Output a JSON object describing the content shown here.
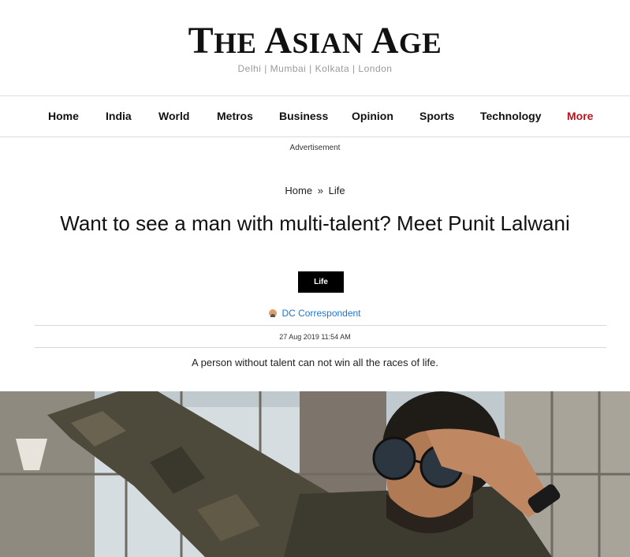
{
  "masthead": {
    "logo_text": "THE ASIAN AGE",
    "cities": "Delhi | Mumbai | Kolkata | London"
  },
  "nav": {
    "items": [
      {
        "label": "Home"
      },
      {
        "label": "India"
      },
      {
        "label": "World"
      },
      {
        "label": "Metros"
      },
      {
        "label": "Business"
      },
      {
        "label": "Opinion"
      },
      {
        "label": "Sports"
      },
      {
        "label": "Technology"
      },
      {
        "label": "More"
      }
    ],
    "accent_color": "#b5161b"
  },
  "advertisement_label": "Advertisement",
  "breadcrumb": {
    "home": "Home",
    "separator": "»",
    "section": "Life"
  },
  "article": {
    "headline": "Want to see a man with multi-talent? Meet Punit Lalwani",
    "category_tag": "Life",
    "author": "DC Correspondent",
    "author_color": "#1f74d1",
    "dateline": "27 Aug 2019 11:54 AM",
    "summary": "A person without talent can not win all the races of life."
  },
  "icons": {
    "author_avatar": "person-avatar-icon"
  }
}
